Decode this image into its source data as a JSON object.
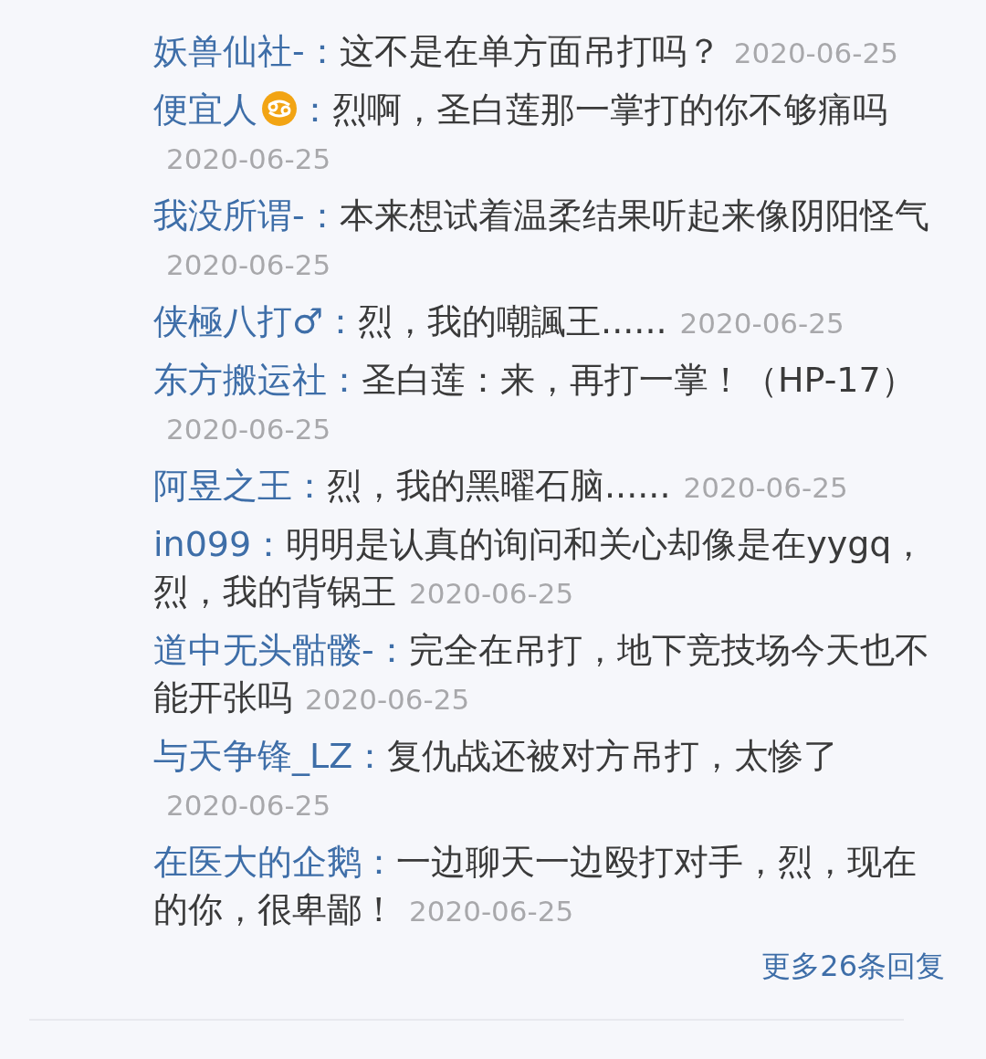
{
  "replies": [
    {
      "name": "妖兽仙社-",
      "badge": false,
      "colon": "：",
      "text": "这不是在单方面吊打吗？",
      "date": "2020-06-25"
    },
    {
      "name": "便宜人",
      "badge": true,
      "colon": "：",
      "text": "烈啊，圣白莲那一掌打的你不够痛吗",
      "date": "2020-06-25"
    },
    {
      "name": "我没所谓-",
      "badge": false,
      "colon": "：",
      "text": "本来想试着温柔结果听起来像阴阳怪气",
      "date": "2020-06-25"
    },
    {
      "name": "侠極八打♂",
      "badge": false,
      "colon": "：",
      "text": "烈，我的嘲諷王......",
      "date": "2020-06-25"
    },
    {
      "name": "东方搬运社",
      "badge": false,
      "colon": "：",
      "text": "圣白莲：来，再打一掌！（HP-17）",
      "date": "2020-06-25"
    },
    {
      "name": "阿昱之王",
      "badge": false,
      "colon": "：",
      "text": "烈，我的黑曜石脑......",
      "date": "2020-06-25"
    },
    {
      "name": "in099",
      "badge": false,
      "colon": "：",
      "text": "明明是认真的询问和关心却像是在yygq，烈，我的背锅王",
      "date": "2020-06-25"
    },
    {
      "name": "道中无头骷髅-",
      "badge": false,
      "colon": "：",
      "text": "完全在吊打，地下竞技场今天也不能开张吗",
      "date": "2020-06-25"
    },
    {
      "name": "与天争锋_LZ",
      "badge": false,
      "colon": "：",
      "text": "复仇战还被对方吊打，太惨了",
      "date": "2020-06-25"
    },
    {
      "name": "在医大的企鹅",
      "badge": false,
      "colon": "：",
      "text": "一边聊天一边殴打对手，烈，现在的你，很卑鄙！",
      "date": "2020-06-25"
    }
  ],
  "more_link": "更多26条回复"
}
